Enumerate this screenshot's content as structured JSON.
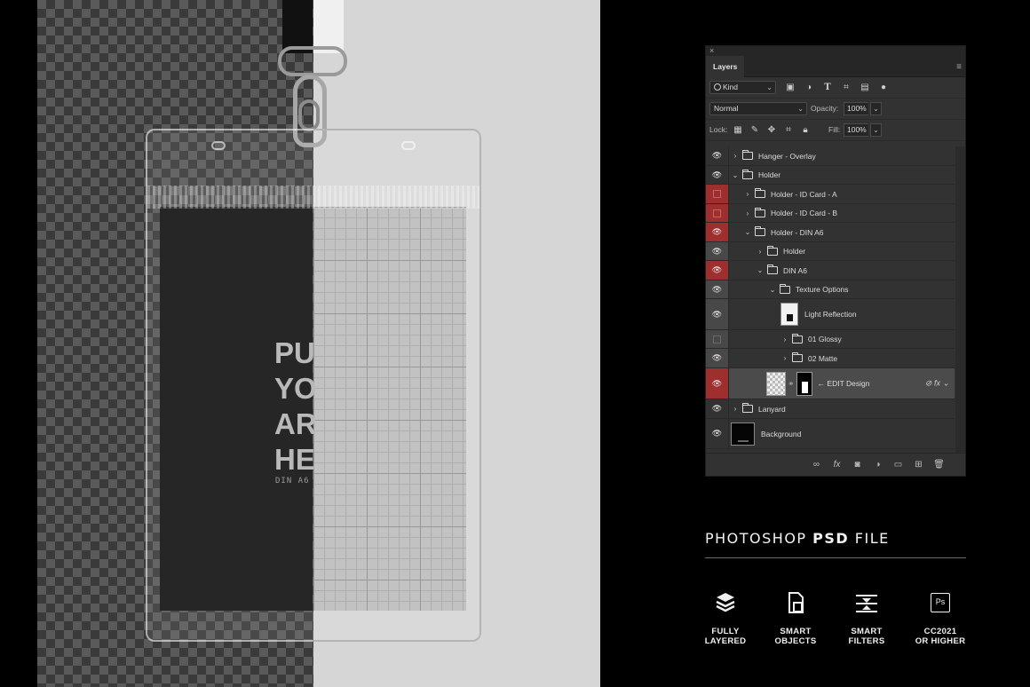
{
  "mockup": {
    "card_text": [
      "PU",
      "YO",
      "AR",
      "HE"
    ],
    "card_subtext": "DIN A6"
  },
  "layers_panel": {
    "close_glyph": "×",
    "tab_title": "Layers",
    "menu_glyph": "≡",
    "filter": {
      "kind_label": "Kind",
      "search_icon": "search-icon"
    },
    "blend_mode": "Normal",
    "opacity_label": "Opacity:",
    "opacity_value": "100%",
    "lock_label": "Lock:",
    "fill_label": "Fill:",
    "fill_value": "100%",
    "layers": [
      {
        "name": "Hanger - Overlay",
        "visibility": "visible",
        "expanded": false,
        "kind": "group"
      },
      {
        "name": "Holder",
        "visibility": "visible",
        "expanded": true,
        "kind": "group"
      },
      {
        "name": "Holder - ID Card - A",
        "visibility": "hidden-red",
        "expanded": false,
        "kind": "group"
      },
      {
        "name": "Holder - ID Card - B",
        "visibility": "hidden-red",
        "expanded": false,
        "kind": "group"
      },
      {
        "name": "Holder - DIN A6",
        "visibility": "visible-red",
        "expanded": true,
        "kind": "group"
      },
      {
        "name": "Holder",
        "visibility": "visible-grey",
        "expanded": false,
        "kind": "group"
      },
      {
        "name": "DIN A6",
        "visibility": "visible-red",
        "expanded": true,
        "kind": "group"
      },
      {
        "name": "Texture Options",
        "visibility": "visible-grey",
        "expanded": true,
        "kind": "group"
      },
      {
        "name": "Light Reflection",
        "visibility": "visible-grey",
        "kind": "pixel"
      },
      {
        "name": "01 Glossy",
        "visibility": "hidden-grey",
        "expanded": false,
        "kind": "group"
      },
      {
        "name": "02 Matte",
        "visibility": "visible-grey",
        "expanded": false,
        "kind": "group"
      },
      {
        "name": "← EDIT Design",
        "visibility": "visible-red",
        "kind": "smart-object",
        "selected": true
      },
      {
        "name": "Lanyard",
        "visibility": "visible",
        "expanded": false,
        "kind": "group"
      },
      {
        "name": "Background",
        "visibility": "visible",
        "kind": "background"
      }
    ]
  },
  "promo": {
    "headline_part1": "PHOTOSHOP ",
    "headline_bold": "PSD",
    "headline_part2": " FILE",
    "features": [
      {
        "icon": "layers-icon",
        "line1": "FULLY",
        "line2": "LAYERED"
      },
      {
        "icon": "smart-object-icon",
        "line1": "SMART",
        "line2": "OBJECTS"
      },
      {
        "icon": "smart-filter-icon",
        "line1": "SMART",
        "line2": "FILTERS"
      },
      {
        "icon": "photoshop-icon",
        "line1": "CC2021",
        "line2": "OR HIGHER",
        "badge": "Ps"
      }
    ]
  },
  "colors": {
    "visibility_red": "#9d2f2f",
    "panel_bg": "#323232",
    "selected_row": "#4b4b4b"
  }
}
